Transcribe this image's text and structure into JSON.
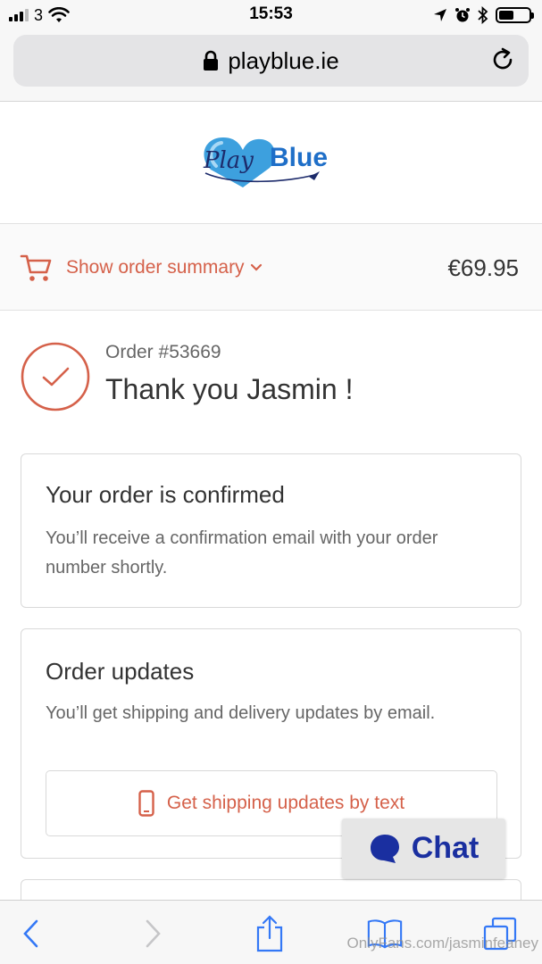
{
  "status_bar": {
    "carrier": "3",
    "time": "15:53",
    "battery_level": 0.5
  },
  "browser": {
    "url": "playblue.ie"
  },
  "store": {
    "logo_text": "PlayBlue"
  },
  "summary": {
    "toggle_label": "Show order summary",
    "total": "€69.95"
  },
  "thank_you": {
    "order_number": "Order #53669",
    "message": "Thank you Jasmin !"
  },
  "confirmed_card": {
    "heading": "Your order is confirmed",
    "body": "You’ll receive a confirmation email with your order number shortly."
  },
  "updates_card": {
    "heading": "Order updates",
    "body": "You’ll get shipping and delivery updates by email.",
    "sms_button": "Get shipping updates by text"
  },
  "chat": {
    "label": "Chat"
  },
  "watermark": "OnlyFans.com/jasminfeaney",
  "colors": {
    "accent": "#d5614a",
    "chat_text": "#1a2fa0",
    "safari_blue": "#3478f6"
  }
}
